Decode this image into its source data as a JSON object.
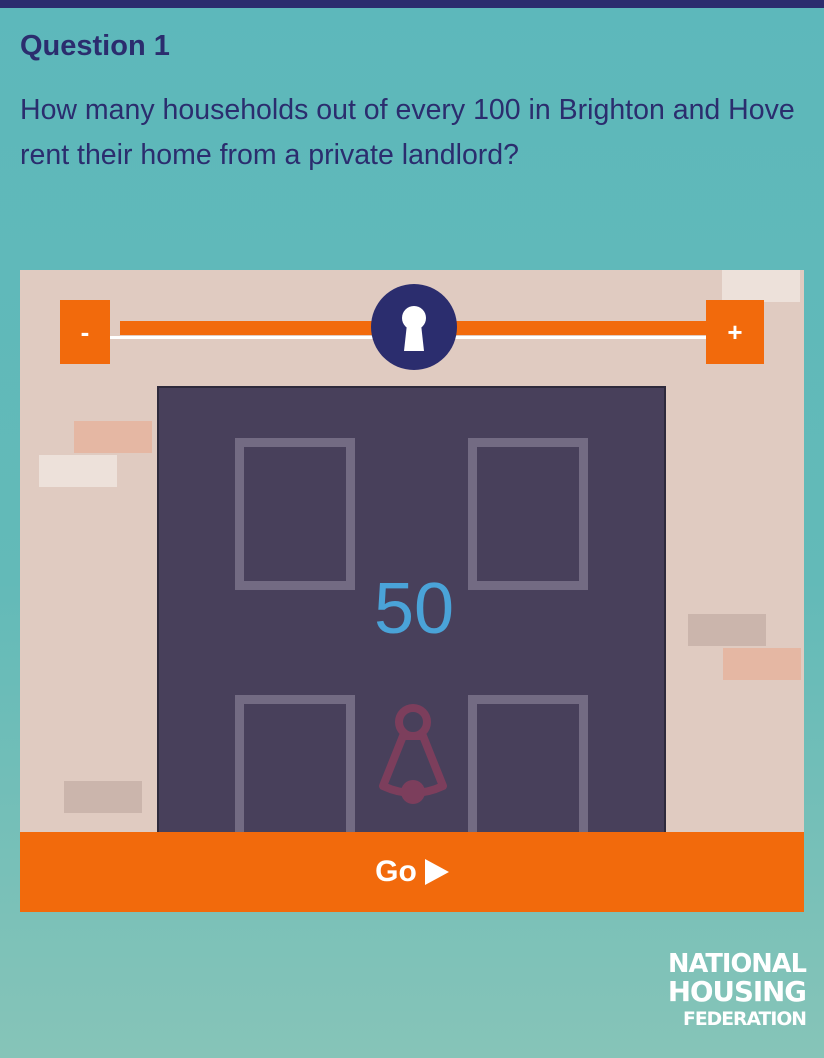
{
  "question": {
    "title": "Question 1",
    "text": "How many households out of every 100 in Brighton and Hove rent their home from a private landlord?"
  },
  "slider": {
    "minus_label": "-",
    "plus_label": "+",
    "value": 50,
    "min": 0,
    "max": 100,
    "value_display": "50"
  },
  "go_button": {
    "label": "Go"
  },
  "logo": {
    "line1": "NATIONAL",
    "line2": "HOUSING",
    "line3": "FEDERATION"
  },
  "colors": {
    "accent_orange": "#f26a0c",
    "navy": "#2b2d6e",
    "teal_background": "#5db8bb",
    "wall": "#e0cbc1",
    "door": "#48405b",
    "value_blue": "#4aa3d8"
  },
  "icons": [
    "keyhole-icon",
    "play-icon",
    "door-knocker-icon"
  ]
}
